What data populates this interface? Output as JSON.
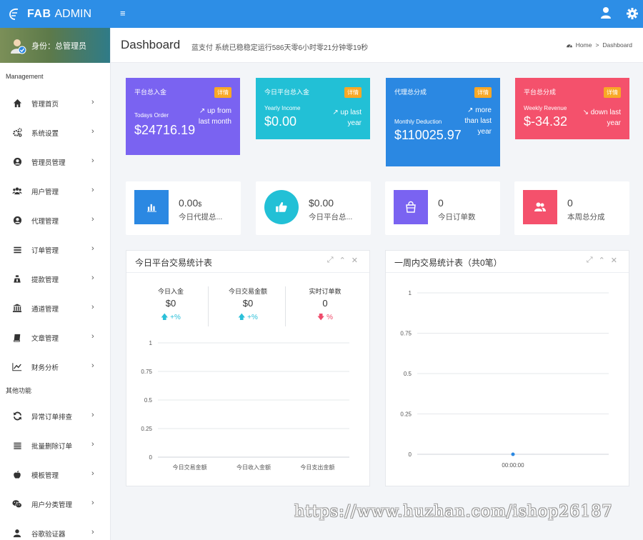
{
  "brand": {
    "name_bold": "FAB",
    "name_rest": "ADMIN"
  },
  "topbar": {
    "menu_icon": "hamburger-icon",
    "user_icon": "user-icon",
    "settings_icon": "gear-icon"
  },
  "sidebar": {
    "profile": "身份：总管理员",
    "section1": "Management",
    "items1": [
      {
        "label": "管理首页",
        "icon": "home-icon"
      },
      {
        "label": "系统设置",
        "icon": "cogs-icon"
      },
      {
        "label": "管理员管理",
        "icon": "user-circle-icon"
      },
      {
        "label": "用户管理",
        "icon": "users-icon"
      },
      {
        "label": "代理管理",
        "icon": "user-circle-icon"
      },
      {
        "label": "订单管理",
        "icon": "list-icon"
      },
      {
        "label": "提款管理",
        "icon": "money-bag-icon"
      },
      {
        "label": "通道管理",
        "icon": "bank-icon"
      },
      {
        "label": "文章管理",
        "icon": "book-icon"
      },
      {
        "label": "财务分析",
        "icon": "line-chart-icon"
      }
    ],
    "section2": "其他功能",
    "items2": [
      {
        "label": "异常订单排查",
        "icon": "refresh-icon"
      },
      {
        "label": "批量删除订单",
        "icon": "list-icon"
      },
      {
        "label": "模板管理",
        "icon": "apple-icon"
      },
      {
        "label": "用户分类管理",
        "icon": "wechat-icon"
      },
      {
        "label": "谷歌验证器",
        "icon": "user-icon"
      }
    ]
  },
  "header": {
    "title": "Dashboard",
    "subtitle": "蓝支付 系统已稳稳定运行586天零6小时零21分钟零19秒",
    "breadcrumb_home": "Home",
    "breadcrumb_sep": ">",
    "breadcrumb_current": "Dashboard"
  },
  "cards": [
    {
      "title": "平台总入金",
      "badge": "详情",
      "label": "Todays Order",
      "value": "$24716.19",
      "trend": "up from last month",
      "color": "#7a63f1"
    },
    {
      "title": "今日平台总入金",
      "badge": "详情",
      "label": "Yearly Income",
      "value": "$0.00",
      "trend": "up last year",
      "color": "#22c0d6"
    },
    {
      "title": "代理总分成",
      "badge": "详情",
      "label": "Monthly Deduction",
      "value": "$110025.97",
      "trend": "more than last year",
      "color": "#2b88e2"
    },
    {
      "title": "平台总分成",
      "badge": "详情",
      "label": "Weekly Revenue",
      "value": "$-34.32",
      "trend": "down last year",
      "color": "#f4516c"
    }
  ],
  "info_boxes": [
    {
      "value": "0.00",
      "unit": "$",
      "label": "今日代提总...",
      "icon": "bar-chart-icon",
      "color": "#2b88e2"
    },
    {
      "value": "$0.00",
      "unit": "",
      "label": "今日平台总...",
      "icon": "thumbs-up-icon",
      "color": "#22c0d6"
    },
    {
      "value": "0",
      "unit": "",
      "label": "今日订单数",
      "icon": "shopping-bag-icon",
      "color": "#7a63f1"
    },
    {
      "value": "0",
      "unit": "",
      "label": "本周总分成",
      "icon": "users-icon",
      "color": "#f4516c"
    }
  ],
  "panel_left": {
    "title": "今日平台交易统计表",
    "stats": [
      {
        "label": "今日入金",
        "value": "$0",
        "change": "+%",
        "dir": "up"
      },
      {
        "label": "今日交易金额",
        "value": "$0",
        "change": "+%",
        "dir": "up"
      },
      {
        "label": "实时订单数",
        "value": "0",
        "change": "%",
        "dir": "down"
      }
    ]
  },
  "panel_right": {
    "title": "一周内交易统计表（共0笔）"
  },
  "chart_data": [
    {
      "type": "bar",
      "categories": [
        "今日交易金额",
        "今日收入金额",
        "今日支出金额"
      ],
      "values": [
        0,
        0,
        0
      ],
      "ylim": [
        0,
        1
      ],
      "yticks": [
        "0",
        "0.25",
        "0.5",
        "0.75",
        "1"
      ],
      "grid": true
    },
    {
      "type": "line",
      "x": [
        "00:00:00"
      ],
      "values": [
        0
      ],
      "ylim": [
        0,
        1
      ],
      "yticks": [
        "0",
        "0.25",
        "0.5",
        "0.75",
        "1"
      ],
      "grid": true,
      "color": "#2b88e2"
    }
  ],
  "watermark": "https://www.huzhan.com/ishop26187"
}
